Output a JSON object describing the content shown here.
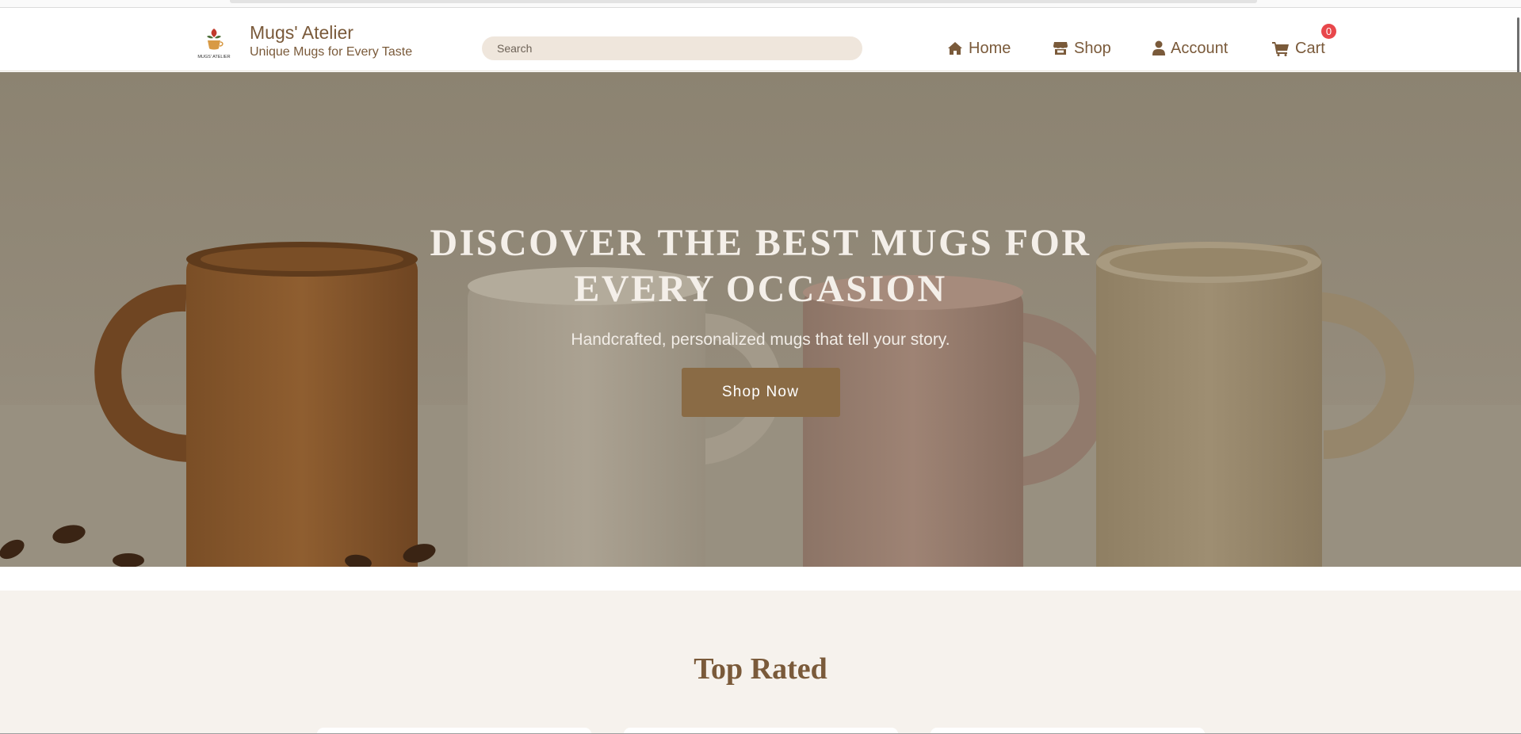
{
  "brand": {
    "name": "Mugs' Atelier",
    "tagline": "Unique Mugs for Every Taste",
    "logo_text": "MUGS' ATELIER"
  },
  "search": {
    "placeholder": "Search"
  },
  "nav": {
    "home": {
      "label": "Home",
      "icon": "home-icon"
    },
    "shop": {
      "label": "Shop",
      "icon": "store-icon"
    },
    "account": {
      "label": "Account",
      "icon": "user-icon"
    },
    "cart": {
      "label": "Cart",
      "icon": "cart-icon",
      "count": "0"
    }
  },
  "hero": {
    "title": "Discover the Best Mugs for Every Occasion",
    "subtitle": "Handcrafted, personalized mugs that tell your story.",
    "cta_label": "Shop Now"
  },
  "top_rated": {
    "title": "Top Rated"
  },
  "colors": {
    "brand_brown": "#7a5a3a",
    "button": "#8a6b45",
    "badge": "#e8474b",
    "search_bg": "#efe6dc",
    "section_bg": "#f6f2ed"
  }
}
